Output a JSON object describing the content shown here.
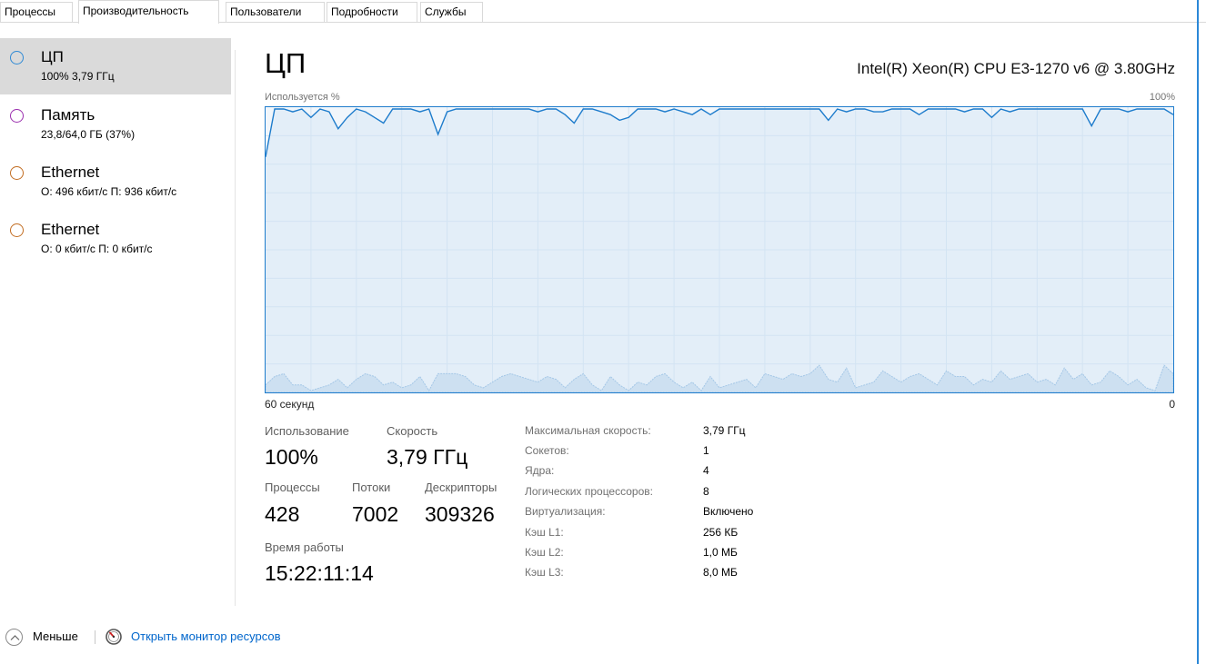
{
  "tabs": [
    {
      "label": "Процессы"
    },
    {
      "label": "Производительность"
    },
    {
      "label": "Пользователи"
    },
    {
      "label": "Подробности"
    },
    {
      "label": "Службы"
    }
  ],
  "sidebar": {
    "items": [
      {
        "title": "ЦП",
        "subtitle": "100% 3,79 ГГц",
        "color": "#2f8ad5",
        "selected": true
      },
      {
        "title": "Память",
        "subtitle": "23,8/64,0 ГБ (37%)",
        "color": "#9b2fae",
        "selected": false
      },
      {
        "title": "Ethernet",
        "subtitle": "О: 496 кбит/с П: 936 кбит/с",
        "color": "#c26d22",
        "selected": false
      },
      {
        "title": "Ethernet",
        "subtitle": "О: 0 кбит/с П: 0 кбит/с",
        "color": "#c26d22",
        "selected": false
      }
    ]
  },
  "main": {
    "title": "ЦП",
    "cpu_name": "Intel(R) Xeon(R) CPU E3-1270 v6 @ 3.80GHz",
    "graph_label_left": "Используется %",
    "graph_label_right": "100%",
    "graph_bottom_left": "60 секунд",
    "graph_bottom_right": "0",
    "accent_color": "#1e7ccc"
  },
  "stats": {
    "usage_label": "Использование",
    "usage_value": "100%",
    "speed_label": "Скорость",
    "speed_value": "3,79 ГГц",
    "processes_label": "Процессы",
    "processes_value": "428",
    "threads_label": "Потоки",
    "threads_value": "7002",
    "handles_label": "Дескрипторы",
    "handles_value": "309326",
    "uptime_label": "Время работы",
    "uptime_value": "15:22:11:14"
  },
  "info": [
    {
      "label": "Максимальная скорость:",
      "value": "3,79 ГГц"
    },
    {
      "label": "Сокетов:",
      "value": "1"
    },
    {
      "label": "Ядра:",
      "value": "4"
    },
    {
      "label": "Логических процессоров:",
      "value": "8"
    },
    {
      "label": "Виртуализация:",
      "value": "Включено"
    },
    {
      "label": "Кэш L1:",
      "value": "256 КБ"
    },
    {
      "label": "Кэш L2:",
      "value": "1,0 МБ"
    },
    {
      "label": "Кэш L3:",
      "value": "8,0 МБ"
    }
  ],
  "footer": {
    "less_label": "Меньше",
    "monitor_link": "Открыть монитор ресурсов"
  },
  "graph_series": {
    "usage_pct": [
      83,
      100,
      100,
      99,
      100,
      97,
      100,
      99,
      93,
      97,
      100,
      99,
      97,
      95,
      100,
      100,
      100,
      99,
      100,
      91,
      99,
      100,
      100,
      100,
      100,
      100,
      100,
      100,
      100,
      100,
      99,
      100,
      100,
      98,
      95,
      100,
      100,
      99,
      98,
      96,
      97,
      100,
      100,
      100,
      99,
      100,
      99,
      98,
      100,
      98,
      100,
      100,
      100,
      100,
      100,
      100,
      100,
      100,
      100,
      100,
      100,
      100,
      96,
      100,
      99,
      100,
      100,
      99,
      99,
      100,
      100,
      100,
      98,
      100,
      100,
      100,
      100,
      99,
      100,
      100,
      97,
      100,
      99,
      100,
      100,
      100,
      100,
      100,
      100,
      100,
      100,
      94,
      100,
      100,
      100,
      99,
      100,
      100,
      100,
      100,
      98
    ],
    "kernel_pct": [
      2,
      5,
      6,
      2,
      2,
      0,
      1,
      2,
      4,
      1,
      4,
      6,
      5,
      2,
      3,
      1,
      2,
      5,
      0,
      6,
      6,
      6,
      5,
      2,
      1,
      3,
      5,
      6,
      5,
      4,
      3,
      5,
      4,
      1,
      4,
      6,
      2,
      0,
      5,
      2,
      0,
      3,
      2,
      5,
      6,
      3,
      1,
      3,
      0,
      5,
      1,
      2,
      3,
      4,
      1,
      6,
      5,
      4,
      6,
      5,
      6,
      9,
      4,
      3,
      8,
      1,
      2,
      3,
      7,
      5,
      3,
      5,
      6,
      4,
      2,
      7,
      5,
      5,
      2,
      4,
      3,
      7,
      4,
      5,
      6,
      3,
      4,
      2,
      8,
      4,
      6,
      2,
      3,
      7,
      5,
      2,
      4,
      1,
      0,
      9,
      6
    ]
  }
}
